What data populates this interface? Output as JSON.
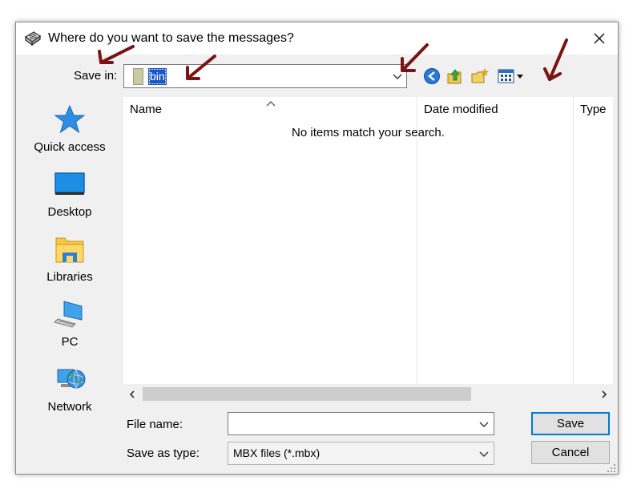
{
  "dialog": {
    "title": "Where do you want to save the messages?",
    "title_icon": "mail-save-icon",
    "close_icon": "close-icon"
  },
  "save_in": {
    "label": "Save in:",
    "folder": "bin"
  },
  "toolbar": {
    "icons": [
      "back-icon",
      "up-folder-icon",
      "new-folder-icon",
      "view-menu-icon"
    ]
  },
  "places": [
    {
      "label": "Quick access",
      "icon": "quick-access-icon"
    },
    {
      "label": "Desktop",
      "icon": "desktop-icon"
    },
    {
      "label": "Libraries",
      "icon": "libraries-icon"
    },
    {
      "label": "PC",
      "icon": "pc-icon"
    },
    {
      "label": "Network",
      "icon": "network-icon"
    }
  ],
  "file_list": {
    "columns": [
      "Name",
      "Date modified",
      "Type"
    ],
    "empty_message": "No items match your search."
  },
  "file_name": {
    "label": "File name:",
    "value": ""
  },
  "save_as_type": {
    "label": "Save as type:",
    "value": "MBX files (*.mbx)"
  },
  "buttons": {
    "save": "Save",
    "cancel": "Cancel"
  },
  "colors": {
    "accent": "#0078d7",
    "selection": "#1a57c4",
    "annotation_arrow": "#7a1414"
  }
}
